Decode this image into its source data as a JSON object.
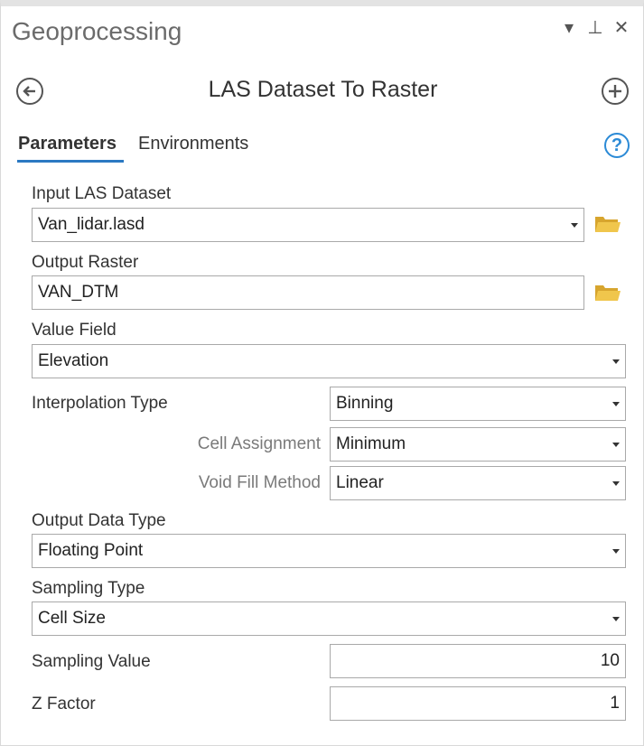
{
  "pane": {
    "title": "Geoprocessing",
    "controls": [
      "▾",
      "⊥",
      "✕"
    ]
  },
  "tool": {
    "title": "LAS Dataset To Raster"
  },
  "tabs": [
    {
      "label": "Parameters",
      "active": true
    },
    {
      "label": "Environments",
      "active": false
    }
  ],
  "help_glyph": "?",
  "params": {
    "input_las": {
      "label": "Input LAS Dataset",
      "value": "Van_lidar.lasd"
    },
    "output_raster": {
      "label": "Output Raster",
      "value": "VAN_DTM"
    },
    "value_field": {
      "label": "Value Field",
      "value": "Elevation"
    },
    "interpolation_type": {
      "label": "Interpolation Type",
      "value": "Binning"
    },
    "cell_assignment": {
      "label": "Cell Assignment",
      "value": "Minimum"
    },
    "void_fill": {
      "label": "Void Fill Method",
      "value": "Linear"
    },
    "output_data_type": {
      "label": "Output Data Type",
      "value": "Floating Point"
    },
    "sampling_type": {
      "label": "Sampling Type",
      "value": "Cell Size"
    },
    "sampling_value": {
      "label": "Sampling Value",
      "value": "10"
    },
    "z_factor": {
      "label": "Z Factor",
      "value": "1"
    }
  },
  "icons": {
    "back": "back-arrow-icon",
    "add": "plus-circle-icon",
    "browse": "folder-icon",
    "dropdown": "chevron-down-icon",
    "help": "help-icon"
  },
  "colors": {
    "accent": "#2b79c2",
    "folder": "#e0b43a",
    "help": "#2b8ad6"
  }
}
